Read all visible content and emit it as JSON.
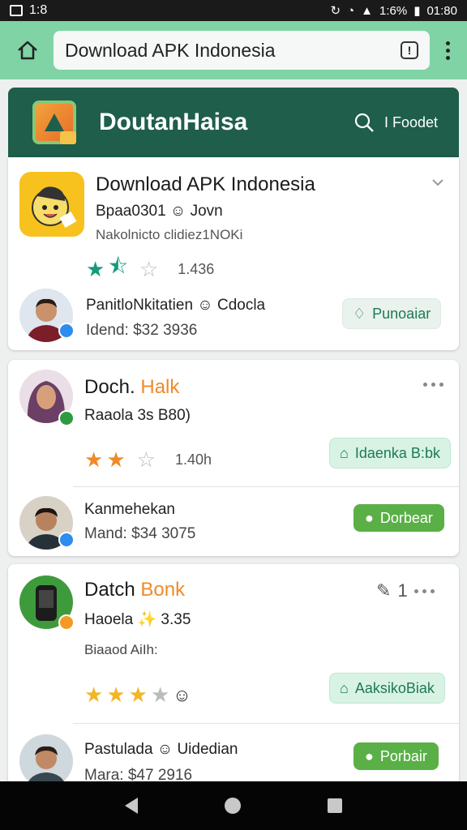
{
  "status": {
    "left_text": "1:8",
    "battery": "1:6%",
    "time": "01:80"
  },
  "browser": {
    "url": "Download APK Indonesia"
  },
  "header": {
    "title": "DoutanHaisa",
    "search_text": "I Foodet"
  },
  "featured": {
    "title": "Download APK Indonesia",
    "subtitle": "Bpaa0301 ☺ Jovn",
    "meta": "Nakolnicto clidiez1NOKi",
    "rating": "1.436",
    "reviewer_name": "PanitloNkitatien ☺ Cdocla",
    "reviewer_price": "Idend: $32 3936",
    "button": "Punoaiar"
  },
  "app2": {
    "title_a": "Doch.",
    "title_b": "Halk",
    "subtitle": "Raaola 3s B80)",
    "rating": "1.40h",
    "button_outline": "Idaenka B:bk",
    "reviewer_name": "Kanmehekan",
    "reviewer_price": "Mand: $34 3075",
    "button": "Dorbear"
  },
  "app3": {
    "title_a": "Datch",
    "title_b": "Bonk",
    "count": "1",
    "subtitle": "Haoela ✨ 3.35",
    "meta": "Biaaod AiIh:",
    "button_outline": "AaksikoBiak",
    "reviewer_name": "Pastulada ☺ Uidedian",
    "reviewer_price": "Mara: $47 2916",
    "button": "Porbair"
  },
  "colors": {
    "accent": "#7fd3a4",
    "header": "#1e5e4a",
    "button": "#5ab046"
  }
}
